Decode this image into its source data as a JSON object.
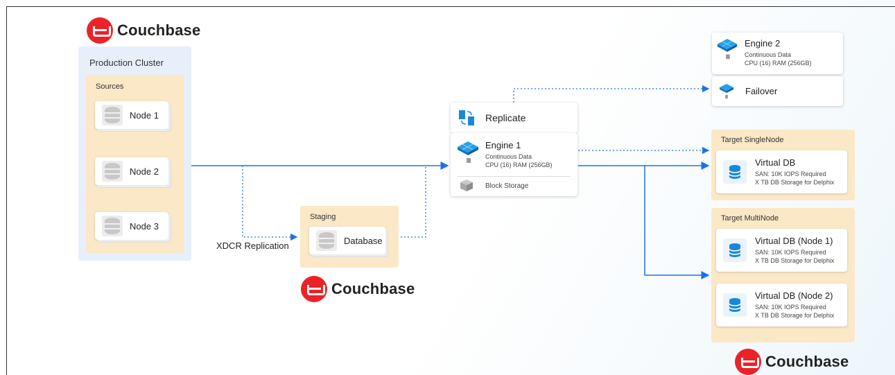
{
  "logos": {
    "top_left": "Couchbase",
    "staging": "Couchbase",
    "bottom_right": "Couchbase"
  },
  "production_cluster": {
    "title": "Production Cluster",
    "sources_title": "Sources",
    "nodes": [
      "Node 1",
      "Node 2",
      "Node 3"
    ]
  },
  "xdcr_label": "XDCR Replication",
  "staging": {
    "title": "Staging",
    "database": "Database"
  },
  "replicate": {
    "label": "Replicate"
  },
  "engine1": {
    "name": "Engine 1",
    "desc": "Continuous Data",
    "spec": "CPU (16) RAM (256GB)",
    "storage": "Block Storage"
  },
  "engine2": {
    "name": "Engine 2",
    "desc": "Continuous Data",
    "spec": "CPU (16) RAM (256GB)"
  },
  "failover": {
    "label": "Failover"
  },
  "target_single": {
    "title": "Target SingleNode",
    "vdb": {
      "name": "Virtual DB",
      "san": "SAN: 10K IOPS Required",
      "storage": "X TB DB Storage for Delphix"
    }
  },
  "target_multi": {
    "title": "Target MultiNode",
    "vdbs": [
      {
        "name": "Virtual DB (Node 1)",
        "san": "SAN: 10K IOPS Required",
        "storage": "X TB DB Storage for Delphix"
      },
      {
        "name": "Virtual DB (Node 2)",
        "san": "SAN: 10K IOPS Required",
        "storage": "X TB DB Storage for Delphix"
      }
    ]
  },
  "colors": {
    "couchbase_red": "#ea2328",
    "connector_blue": "#1a73e8",
    "cluster_bg": "#e7effa",
    "group_bg": "#fbe8c6"
  }
}
